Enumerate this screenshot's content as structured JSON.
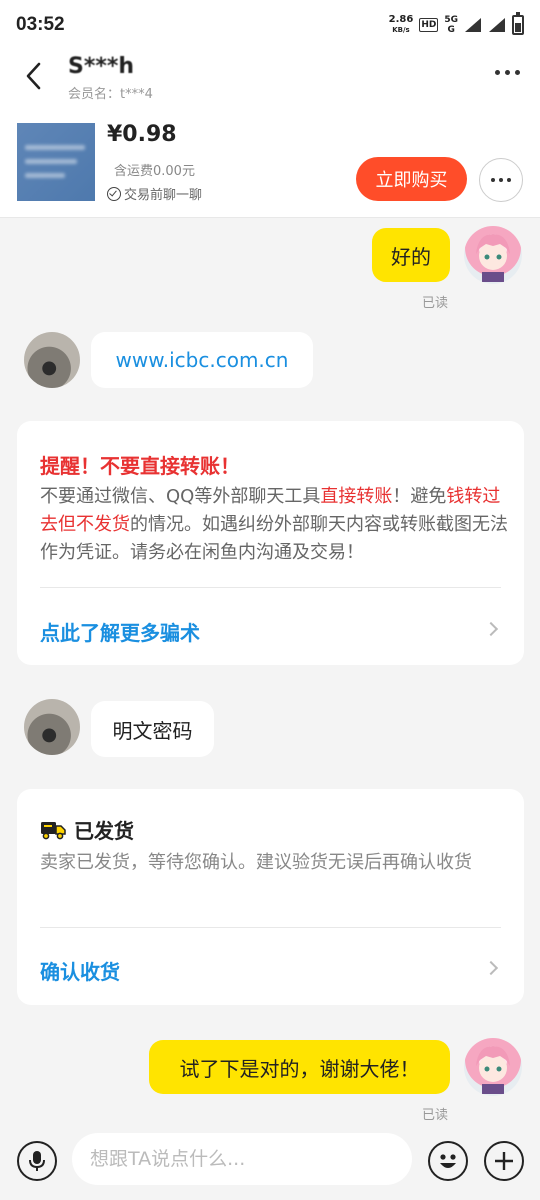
{
  "status_bar": {
    "time": "03:52",
    "net_speed_value": "2.86",
    "net_speed_unit": "KB/s",
    "hd_label": "HD",
    "signal_label_top": "5G",
    "signal_label_bottom": "G"
  },
  "header": {
    "contact_name": "S***h",
    "member_label": "会员名：t***4"
  },
  "product": {
    "price": "¥0.98",
    "shipping": "含运费0.00元",
    "trade_hint": "交易前聊一聊",
    "buy_label": "立即购买"
  },
  "messages": {
    "msg1_text": "好的",
    "msg1_status": "已读",
    "msg2_text": "www.icbc.com.cn",
    "msg3_text": "明文密码",
    "msg4_text": "试了下是对的，谢谢大佬！",
    "msg4_status": "已读"
  },
  "warning_card": {
    "title": "提醒！不要直接转账！",
    "body_part1": "不要通过微信、QQ等外部聊天工具",
    "body_red1": "直接转账",
    "body_part2": "！避免",
    "body_red2": "钱转过去但不发货",
    "body_part3": "的情况。如遇纠纷外部聊天内容或转账截图无法作为凭证。请务必在闲鱼内沟通及交易！",
    "link_label": "点此了解更多骗术"
  },
  "shipping_card": {
    "title": "已发货",
    "body": "卖家已发货，等待您确认。建议验货无误后再确认收货",
    "link_label": "确认收货"
  },
  "input_bar": {
    "placeholder": "想跟TA说点什么..."
  },
  "colors": {
    "buy_button": "#ff4d29",
    "bubble_self": "#ffe400",
    "link": "#1a8fe0",
    "warning": "#e83232"
  },
  "icons": [
    "back-arrow-icon",
    "more-dots-icon",
    "check-circle-icon",
    "truck-icon",
    "chevron-right-icon",
    "microphone-icon",
    "emoji-icon",
    "plus-icon"
  ]
}
